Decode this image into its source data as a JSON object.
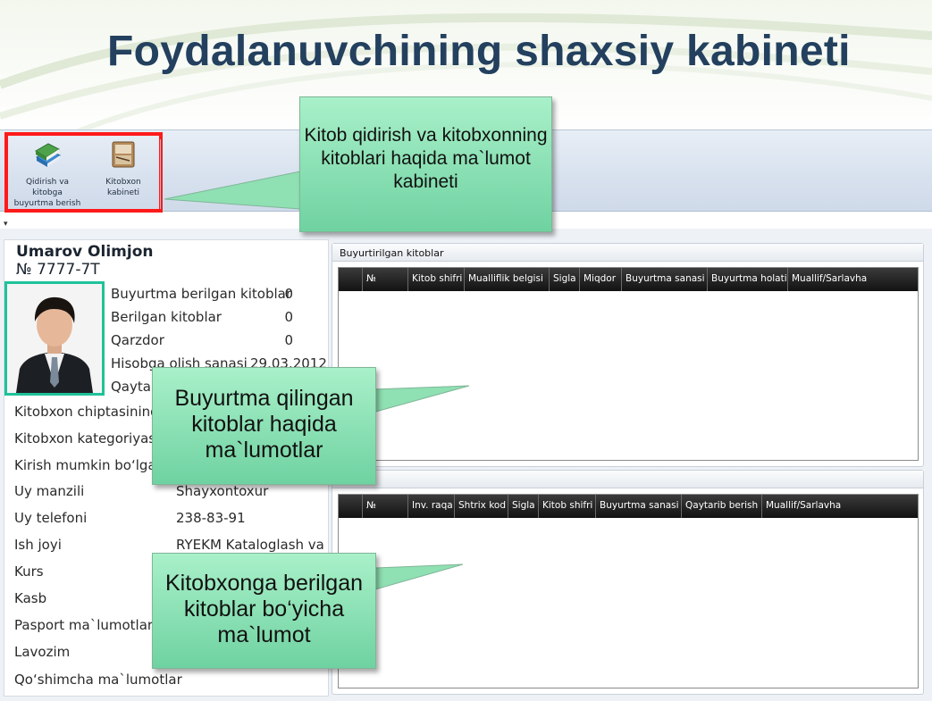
{
  "slide": {
    "title": "Foydalanuvchining shaxsiy kabineti"
  },
  "ribbon": {
    "buttons": [
      {
        "label": "Qidirish va kitobga buyurtma berish"
      },
      {
        "label": "Kitobxon kabineti"
      }
    ]
  },
  "user": {
    "name": "Umarov Olimjon",
    "id": "№ 7777-7T"
  },
  "stats": [
    {
      "label": "Buyurtma berilgan kitoblar",
      "value": "0"
    },
    {
      "label": "Berilgan kitoblar",
      "value": "0"
    },
    {
      "label": "Qarzdor",
      "value": "0"
    },
    {
      "label": "Hisobga olish sanasi",
      "value": "29.03.2012"
    },
    {
      "label": "Qayta ",
      "value": ""
    }
  ],
  "info": [
    {
      "label": "Kitobxon chiptasining",
      "value": ""
    },
    {
      "label": "Kitobxon kategoriyas",
      "value": ""
    },
    {
      "label": "Kirish mumkin bo‘lga",
      "value": ""
    },
    {
      "label": "Uy manzili",
      "value": "Shayxontoxur"
    },
    {
      "label": "Uy telefoni",
      "value": "238-83-91"
    },
    {
      "label": "Ish joyi",
      "value": "RYEKM Kataloglash va"
    },
    {
      "label": "Kurs",
      "value": ""
    },
    {
      "label": "Kasb",
      "value": ""
    },
    {
      "label": "Pasport ma`lumotlari",
      "value": ""
    },
    {
      "label": "Lavozim",
      "value": ""
    },
    {
      "label": "Qo‘shimcha ma`lumotlar",
      "value": ""
    }
  ],
  "ordered_panel": {
    "title": "Buyurtirilgan kitoblar",
    "columns": [
      "",
      "№",
      "Kitob shifri",
      "Mualliflik belgisi",
      "Sigla",
      "Miqdor",
      "Buyurtma sanasi",
      "Buyurtma holati",
      "Muallif/Sarlavha"
    ]
  },
  "issued_panel": {
    "title": "'lda",
    "columns": [
      "",
      "№",
      "Inv. raqa",
      "Shtrix kod",
      "Sigla",
      "Kitob shifri",
      "Buyurtma sanasi",
      "Qaytarib berish",
      "Muallif/Sarlavha"
    ]
  },
  "callouts": {
    "ribbon_note": "Kitob qidirish va kitobxonning kitoblari haqida ma`lumot kabineti",
    "ordered_note": "Buyurtma qilingan kitoblar haqida ma`lumotlar",
    "issued_note": "Kitobxonga berilgan kitoblar bo‘yicha ma`lumot"
  },
  "colors": {
    "title": "#23405e",
    "highlight_border": "#ff1a1a",
    "photo_border": "#1fc29a",
    "callout": "#8fe3b6",
    "grid_header": "#1e1e1e"
  },
  "icons": {
    "search_order": "books-icon",
    "cabinet": "reader-cabinet-icon"
  }
}
